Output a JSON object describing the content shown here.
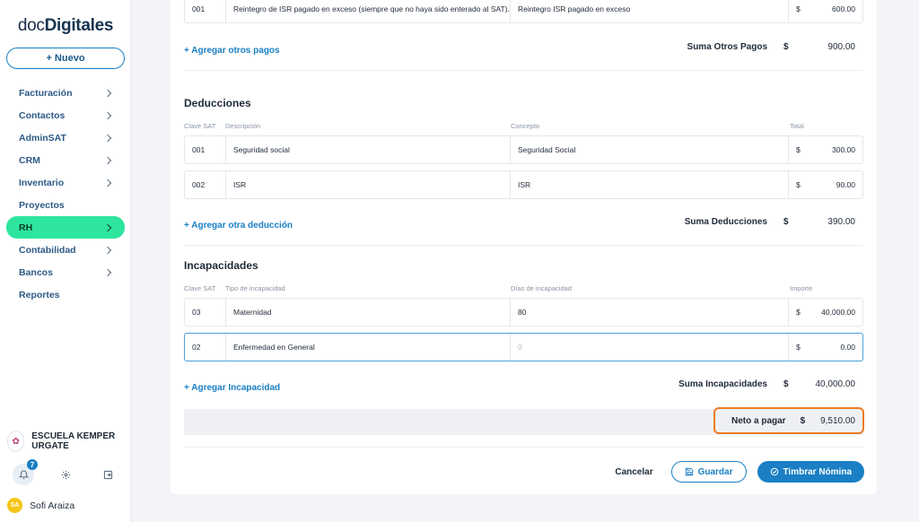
{
  "sidebar": {
    "logo_prefix": "doc",
    "logo_brand": "Digitales",
    "new_button": "+ Nuevo",
    "items": [
      {
        "label": "Facturación"
      },
      {
        "label": "Contactos"
      },
      {
        "label": "AdminSAT"
      },
      {
        "label": "CRM"
      },
      {
        "label": "Inventario"
      },
      {
        "label": "Proyectos"
      },
      {
        "label": "RH"
      },
      {
        "label": "Contabilidad"
      },
      {
        "label": "Bancos"
      },
      {
        "label": "Reportes"
      }
    ],
    "company_name": "ESCUELA KEMPER URGATE",
    "notification_count": "7",
    "user_initials": "SA",
    "user_name": "Sofi Araiza"
  },
  "otros_pagos": {
    "row": {
      "clave": "001",
      "descripcion": "Reintegro de ISR pagado en exceso (siempre que no haya sido enterado al SAT).",
      "concepto": "Reintegro ISR pagado en exceso",
      "currency": "$",
      "total": "600.00"
    },
    "add_link": "+ Agregar otros pagos",
    "sum_label": "Suma Otros Pagos",
    "sum_currency": "$",
    "sum_value": "900.00"
  },
  "deducciones": {
    "title": "Deducciones",
    "headers": {
      "clave": "Clave SAT",
      "descripcion": "Descripción",
      "concepto": "Concepto",
      "total": "Total"
    },
    "rows": [
      {
        "clave": "001",
        "descripcion": "Seguridad social",
        "concepto": "Seguridad Social",
        "currency": "$",
        "total": "300.00"
      },
      {
        "clave": "002",
        "descripcion": "ISR",
        "concepto": "ISR",
        "currency": "$",
        "total": "90.00"
      }
    ],
    "add_link": "+ Agregar otra deducción",
    "sum_label": "Suma Deducciones",
    "sum_currency": "$",
    "sum_value": "390.00"
  },
  "incapacidades": {
    "title": "Incapacidades",
    "headers": {
      "clave": "Clave SAT",
      "tipo": "Tipo de incapacidad",
      "dias": "Días de incapacidad",
      "importe": "Importe"
    },
    "rows": [
      {
        "clave": "03",
        "tipo": "Maternidad",
        "dias": "80",
        "currency": "$",
        "importe": "40,000.00"
      },
      {
        "clave": "02",
        "tipo": "Enfermedad en General",
        "dias_placeholder": "0",
        "currency": "$",
        "importe": "0.00"
      }
    ],
    "add_link": "+ Agregar Incapacidad",
    "sum_label": "Suma Incapacidades",
    "sum_currency": "$",
    "sum_value": "40,000.00"
  },
  "neto": {
    "label": "Neto a pagar",
    "currency": "$",
    "value": "9,510.00"
  },
  "actions": {
    "cancel": "Cancelar",
    "save": "Guardar",
    "stamp": "Timbrar Nómina"
  },
  "colors": {
    "accent": "#1a7fc4",
    "active_nav": "#2ee59d",
    "highlight": "#ee7b22"
  }
}
